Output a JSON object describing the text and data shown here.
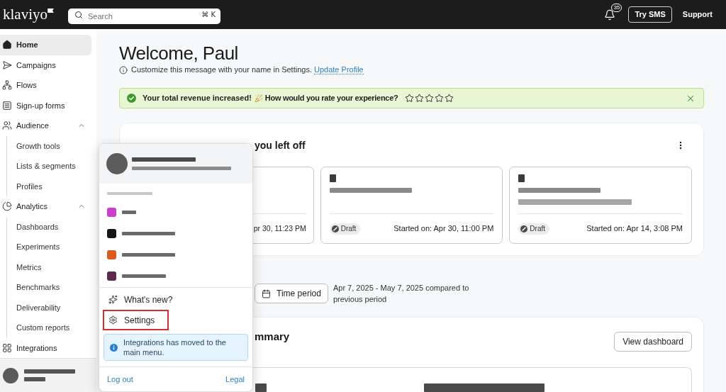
{
  "top_bar": {
    "logo": "klaviyo",
    "search": {
      "placeholder": "Search",
      "shortcut": "⌘ K"
    },
    "notification_count": "35",
    "buttons": [
      {
        "label": "Try SMS",
        "kind": "outlined"
      },
      {
        "label": "Support",
        "kind": "text"
      }
    ]
  },
  "sidebar": {
    "items": [
      {
        "label": "Home",
        "selected": true
      },
      {
        "label": "Campaigns",
        "selected": false
      },
      {
        "label": "Flows",
        "selected": false
      },
      {
        "label": "Sign-up forms",
        "selected": false
      },
      {
        "label": "Audience",
        "selected": false,
        "expanded": true,
        "children": [
          {
            "label": "Growth tools",
            "selected": false
          },
          {
            "label": "Lists & segments",
            "selected": false
          },
          {
            "label": "Profiles",
            "selected": false
          }
        ]
      },
      {
        "label": "Analytics",
        "selected": false,
        "expanded": true,
        "children": [
          {
            "label": "Dashboards",
            "selected": false
          },
          {
            "label": "Experiments",
            "selected": false
          },
          {
            "label": "Metrics",
            "selected": false
          },
          {
            "label": "Benchmarks",
            "selected": false
          },
          {
            "label": "Deliverability",
            "selected": false
          },
          {
            "label": "Custom reports",
            "selected": false
          }
        ]
      },
      {
        "label": "Integrations",
        "selected": false
      }
    ]
  },
  "welcome": {
    "title": "Welcome, Paul",
    "hint": "Customize this message with your name in Settings.",
    "link": "Update Profile"
  },
  "banner": {
    "message": "Your total revenue increased!",
    "question": "How would you rate your experience?",
    "stars": 0
  },
  "recent_work": {
    "title": "you left off",
    "cards": [
      {
        "started": "pr 30, 11:23 PM"
      },
      {
        "status": "Draft",
        "started": "Started on: Apr 30, 11:00 PM"
      },
      {
        "status": "Draft",
        "started": "Started on: Apr 14, 3:08 PM"
      }
    ]
  },
  "time_filter": {
    "button": "Time period",
    "range": "Apr 7, 2025 - May 7, 2025 compared to previous period"
  },
  "summary": {
    "title": "mmary",
    "button": "View dashboard"
  },
  "account_menu": {
    "accounts": [
      {
        "color": "#c93fc7"
      },
      {
        "color": "#151515"
      },
      {
        "color": "#de5a1e"
      },
      {
        "color": "#5e2a4c"
      }
    ],
    "items": [
      {
        "label": "What's new?",
        "highlighted": false
      },
      {
        "label": "Settings",
        "highlighted": true
      }
    ],
    "notice": "Integrations has moved to the main menu.",
    "links": [
      "Log out",
      "Legal"
    ]
  }
}
